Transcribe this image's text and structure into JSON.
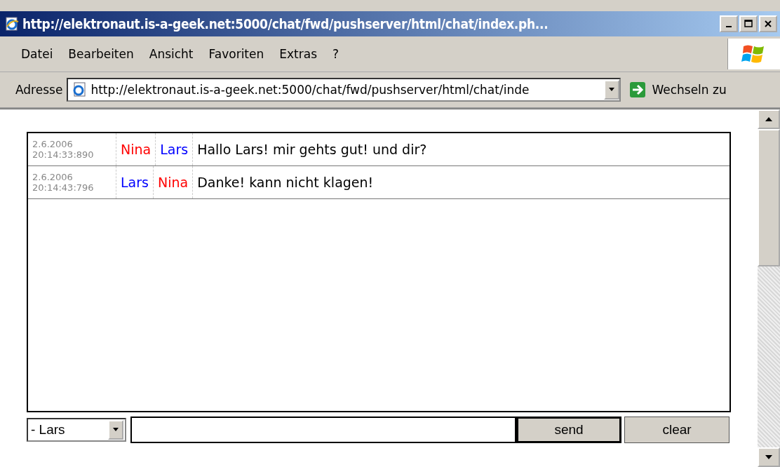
{
  "window": {
    "title": "http://elektronaut.is-a-geek.net:5000/chat/fwd/pushserver/html/chat/index.ph..."
  },
  "menu": [
    "Datei",
    "Bearbeiten",
    "Ansicht",
    "Favoriten",
    "Extras",
    "?"
  ],
  "address_bar": {
    "label": "Adresse",
    "value": "http://elektronaut.is-a-geek.net:5000/chat/fwd/pushserver/html/chat/inde",
    "go_button": "Wechseln zu"
  },
  "messages": [
    {
      "date": "2.6.2006",
      "time": "20:14:33:890",
      "from": {
        "name": "Nina",
        "color": "#ff0000"
      },
      "to": {
        "name": "Lars",
        "color": "#0000ff"
      },
      "text": "Hallo Lars! mir gehts gut! und dir?"
    },
    {
      "date": "2.6.2006",
      "time": "20:14:43:796",
      "from": {
        "name": "Lars",
        "color": "#0000ff"
      },
      "to": {
        "name": "Nina",
        "color": "#ff0000"
      },
      "text": "Danke! kann nicht klagen!"
    }
  ],
  "compose": {
    "recipient": "- Lars",
    "send": "send",
    "clear": "clear"
  }
}
